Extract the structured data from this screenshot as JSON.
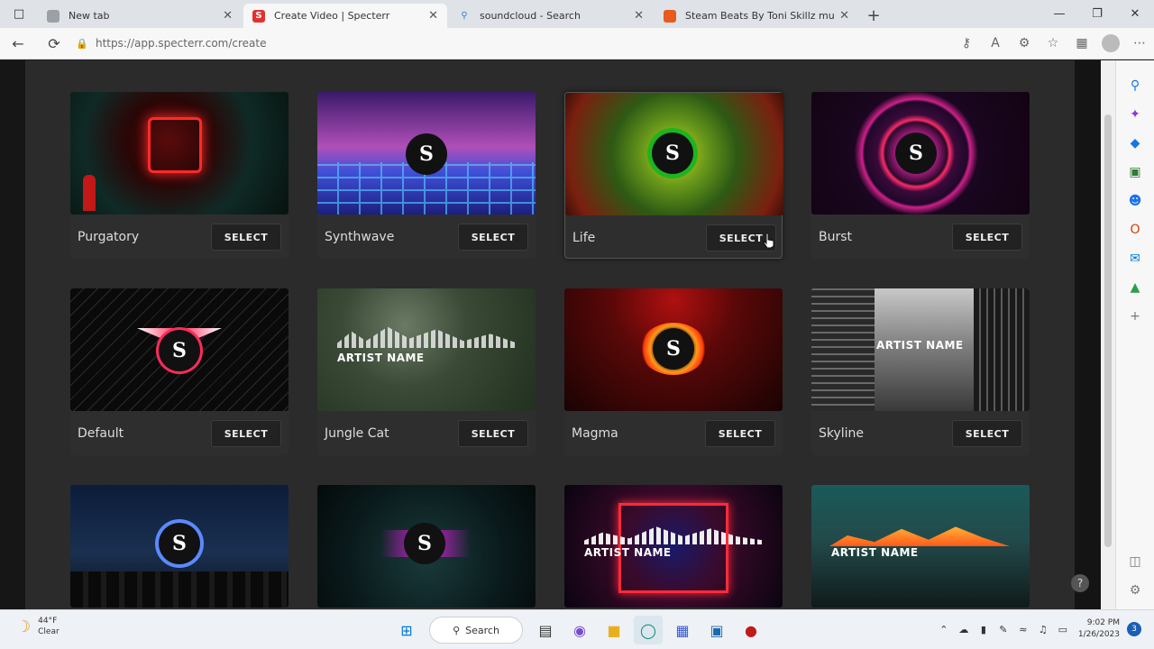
{
  "browser": {
    "tabs": [
      {
        "title": "New tab",
        "icon": "newtab-icon",
        "color": "#9aa0a6"
      },
      {
        "title": "Create Video | Specterr",
        "icon": "specterr-icon",
        "color": "#e0332f",
        "active": true
      },
      {
        "title": "soundcloud - Search",
        "icon": "search-icon",
        "color": "#3a7bd5"
      },
      {
        "title": "Steam Beats By Toni Skillz musi",
        "icon": "soundcloud-icon",
        "color": "#e85a1e"
      }
    ],
    "url": "https://app.specterr.com/create"
  },
  "templates": [
    {
      "name": "Purgatory",
      "button": "SELECT"
    },
    {
      "name": "Synthwave",
      "button": "SELECT"
    },
    {
      "name": "Life",
      "button": "SELECT"
    },
    {
      "name": "Burst",
      "button": "SELECT"
    },
    {
      "name": "Default",
      "button": "SELECT"
    },
    {
      "name": "Jungle Cat",
      "button": "SELECT",
      "artist": "ARTIST NAME"
    },
    {
      "name": "Magma",
      "button": "SELECT"
    },
    {
      "name": "Skyline",
      "button": "SELECT",
      "artist": "ARTIST NAME"
    },
    {
      "name": "",
      "button": ""
    },
    {
      "name": "",
      "button": ""
    },
    {
      "name": "",
      "button": "",
      "artist": "ARTIST NAME"
    },
    {
      "name": "",
      "button": "",
      "artist": "ARTIST NAME"
    }
  ],
  "help": "?",
  "taskbar": {
    "weather_temp": "44°F",
    "weather_desc": "Clear",
    "search_label": "Search",
    "time": "9:02 PM",
    "date": "1/26/2023",
    "notifications": "3"
  }
}
